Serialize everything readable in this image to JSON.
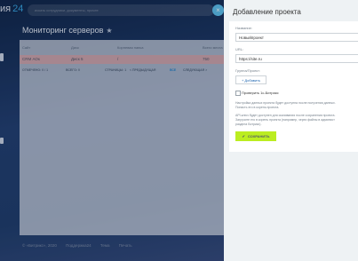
{
  "header": {
    "logo_name": "ия",
    "logo_num": "24",
    "search_placeholder": "искать сотрудники, документы, прочее",
    "close_glyph": "×"
  },
  "page": {
    "title": "Мониторинг серверов",
    "star_glyph": "★"
  },
  "table": {
    "columns": [
      "Сайт",
      "Диск",
      "Корневая папка",
      "Всего места"
    ],
    "rows": [
      {
        "site": "CRM АОк",
        "disk": "Диск 5",
        "folder": "/",
        "total": "750"
      }
    ]
  },
  "pager": {
    "shown_label": "ОТМЕЧЕНО: 0 / 1",
    "total_label": "ВСЕГО: 0",
    "pages_label": "СТРАНИЦЫ: 1",
    "prev_label": "< ПРЕДЫДУЩАЯ",
    "all_label": "ВСЕ",
    "next_label": "СЛЕДУЮЩАЯ >"
  },
  "footer": {
    "copyright": "© «Битрикс», 2020",
    "links": [
      "Поддержка24",
      "Тема",
      "Печать"
    ]
  },
  "slider": {
    "title": "Добавление проекта",
    "name_label": "Название:",
    "name_value": "Новыйпроект",
    "url_label": "URL:",
    "url_value": "https://site.ru",
    "group_label": "Группа/Проект:",
    "add_button": "+ Добавить",
    "check_label": "Проверить 1с-Битрикс",
    "note1_line1": "Настройка данных проекта будет доступна после получения данных.",
    "note1_line2": "Попасть его в корень проекта.",
    "note2_line1": "API-ключ будет доступен для скачивания после сохранения проекта.",
    "note2_line2": "Загрузите его в корень проекта (например, через файлы в админист",
    "note2_line3": "раздела Битрикс).",
    "save_button": "СОХРАНИТЬ",
    "save_check": "✔"
  },
  "colors": {
    "accent": "#bbed21",
    "link": "#2067b0",
    "row_highlight": "#d3a7ac"
  }
}
